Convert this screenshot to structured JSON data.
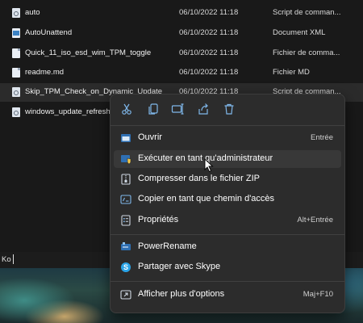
{
  "explorer": {
    "files": [
      {
        "name": "auto",
        "date": "06/10/2022 11:18",
        "type": "Script de comman...",
        "icon": "gear-file-icon"
      },
      {
        "name": "AutoUnattend",
        "date": "06/10/2022 11:18",
        "type": "Document XML",
        "icon": "xml-file-icon"
      },
      {
        "name": "Quick_11_iso_esd_wim_TPM_toggle",
        "date": "06/10/2022 11:18",
        "type": "Fichier de comma...",
        "icon": "file-icon"
      },
      {
        "name": "readme.md",
        "date": "06/10/2022 11:18",
        "type": "Fichier MD",
        "icon": "file-icon"
      },
      {
        "name": "Skip_TPM_Check_on_Dynamic_Update",
        "date": "06/10/2022 11:18",
        "type": "Script de comman...",
        "icon": "gear-file-icon"
      },
      {
        "name": "windows_update_refresh",
        "date": "",
        "type": "",
        "icon": "gear-file-icon"
      }
    ],
    "status": "Ko"
  },
  "context_menu": {
    "quick_actions": [
      "cut-icon",
      "copy-icon",
      "rename-icon",
      "share-icon",
      "delete-icon"
    ],
    "items": [
      {
        "label": "Ouvrir",
        "shortcut": "Entrée",
        "icon": "open-icon"
      },
      {
        "label": "Exécuter en tant qu'administrateur",
        "shortcut": "",
        "icon": "shield-admin-icon"
      },
      {
        "label": "Compresser dans le fichier ZIP",
        "shortcut": "",
        "icon": "zip-icon"
      },
      {
        "label": "Copier en tant que chemin d'accès",
        "shortcut": "",
        "icon": "copy-path-icon"
      },
      {
        "label": "Propriétés",
        "shortcut": "Alt+Entrée",
        "icon": "properties-icon"
      },
      {
        "label": "PowerRename",
        "shortcut": "",
        "icon": "powerrename-icon"
      },
      {
        "label": "Partager avec Skype",
        "shortcut": "",
        "icon": "skype-icon"
      },
      {
        "label": "Afficher plus d'options",
        "shortcut": "Maj+F10",
        "icon": "more-options-icon"
      }
    ]
  },
  "colors": {
    "background": "#191919",
    "menu_background": "#2c2c2c",
    "accent_blue": "#4aa3f0"
  }
}
